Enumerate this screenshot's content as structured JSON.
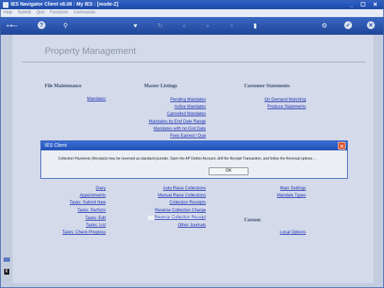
{
  "window": {
    "title": "IES Navigator Client v8.08 : My IES :       [mode-Z]",
    "controls": "_ ☐ ✕"
  },
  "menubar": [
    "Help",
    "Submit",
    "Quit",
    "Functions",
    "Commands"
  ],
  "toolbar": {
    "icons": [
      "key-icon",
      "help-icon",
      "search-icon",
      "heart-icon",
      "refresh-icon",
      "back-icon",
      "forward-icon",
      "tree-icon",
      "copy-icon",
      "tools-icon",
      "check-icon",
      "close-icon"
    ]
  },
  "page": {
    "title": "Property Management"
  },
  "sections": {
    "file_maintenance": "File Maintenance",
    "master_listings": "Master Listings",
    "customer_statements": "Customer Statements",
    "custom": "Custom"
  },
  "links": {
    "mandates": "Mandates",
    "pending_mandates": "Pending Mandates",
    "active_mandates": "Active Mandates",
    "cancelled_mandates": "Cancelled Mandates",
    "mandates_by_end_date_range": "Mandates by End Date Range",
    "mandates_no_end_date": "Mandates with no End Date",
    "fees_earned_due": "Fees Earned / Due",
    "on_demand_matching": "On Demand Matching",
    "produce_statements": "Produce Statements",
    "diary": "Diary",
    "appointments": "Appointments",
    "tasks_submit_new": "Tasks: Submit New",
    "tasks_perform": "Tasks: Perform",
    "tasks_edit": "Tasks: Edit",
    "tasks_list": "Tasks: List",
    "tasks_check_progress": "Tasks: Check Progress",
    "auto_raise_collections": "Auto Raise Collections",
    "manual_raise_collections": "Manual Raise Collections",
    "collection_receipts": "Collection Receipts",
    "reverse_collection_charge": "Reverse Collection Charge",
    "reverse_collection_receipt": "Reverse Collection Receipt",
    "other_journals": "Other Journals",
    "main_settings": "Main Settings",
    "mandate_types": "Mandate Types",
    "local_options": "Local Options"
  },
  "dialog": {
    "title": "IES Client",
    "message": "Collection Payments (Receipts) may be reversed as standard journals. Open the AP Debtor Account, drill the Receipt Transaction, and follow the Reversal options ...",
    "ok_label": "OK"
  }
}
